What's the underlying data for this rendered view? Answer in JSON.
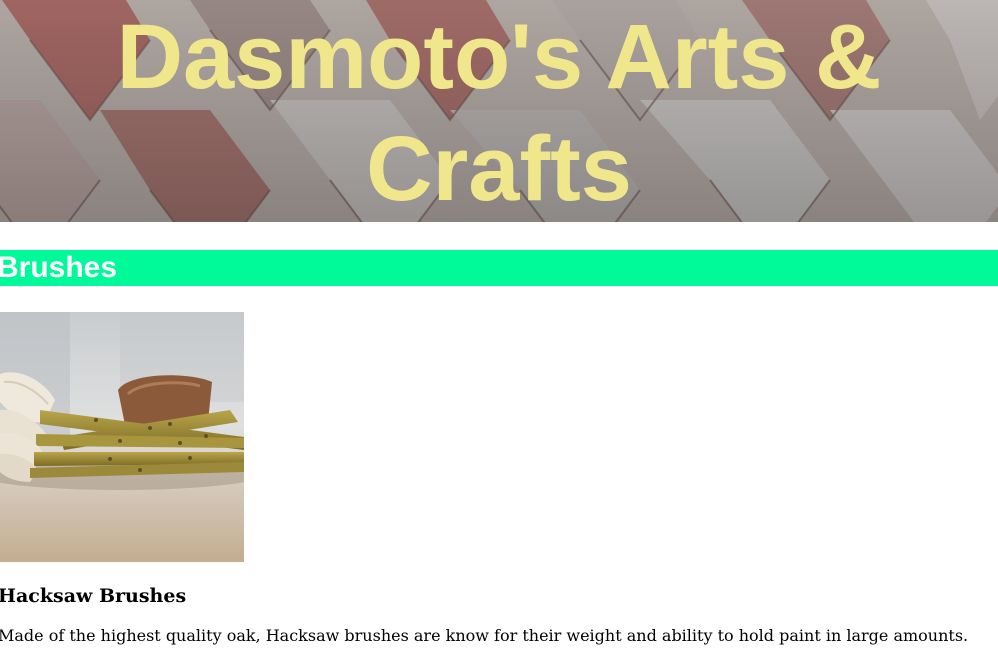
{
  "header": {
    "title": "Dasmoto's Arts & Crafts",
    "background": "brick-tile-roof-image"
  },
  "sections": [
    {
      "heading": "Brushes",
      "heading_bar_color": "#00fa9a",
      "product": {
        "image": "paintbrushes-image",
        "name": "Hacksaw Brushes",
        "description": "Made of the highest quality oak, Hacksaw brushes are know for their weight and ability to hold paint in large amounts."
      }
    }
  ],
  "colors": {
    "title_text": "#f0e68c",
    "section_heading_text": "#ffffff"
  }
}
